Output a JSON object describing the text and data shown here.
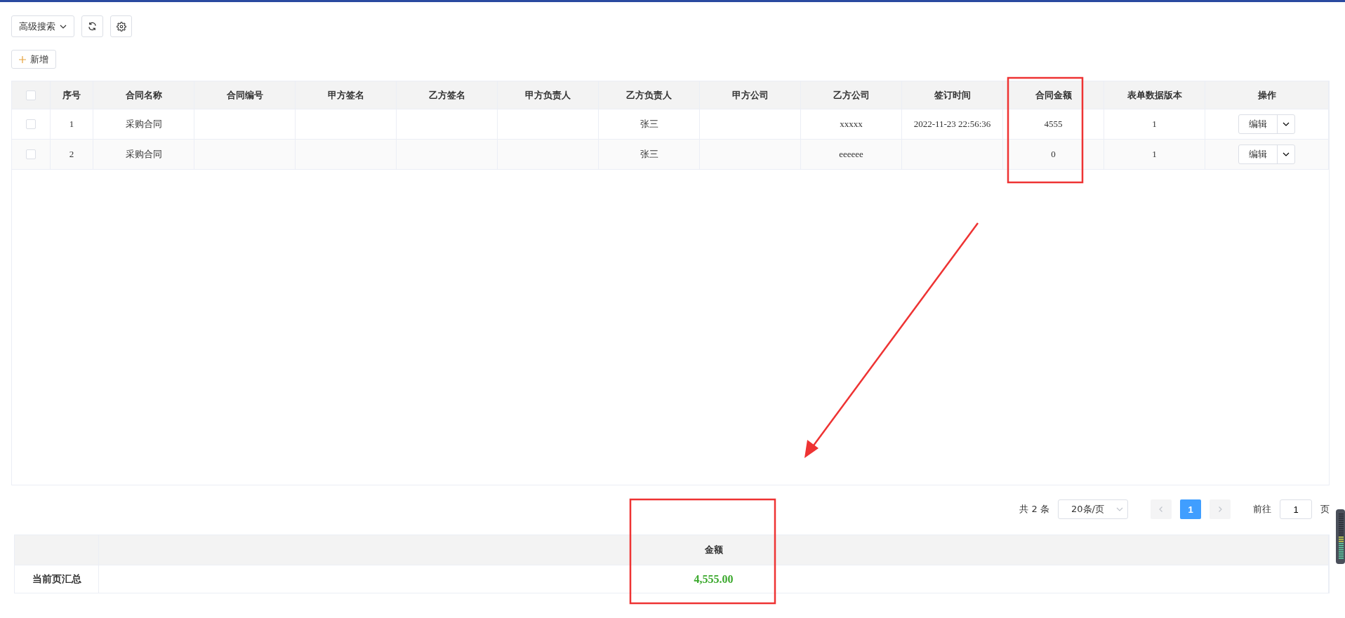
{
  "toolbar": {
    "search_button": "高级搜索",
    "add_button": "新增"
  },
  "table": {
    "columns": [
      "序号",
      "合同名称",
      "合同编号",
      "甲方签名",
      "乙方签名",
      "甲方负责人",
      "乙方负责人",
      "甲方公司",
      "乙方公司",
      "签订时间",
      "合同金额",
      "表单数据版本",
      "操作"
    ],
    "header_checked": false,
    "rows": [
      {
        "checked": false,
        "cells": [
          "1",
          "采购合同",
          "",
          "",
          "",
          "",
          "张三",
          "",
          "xxxxx",
          "2022-11-23 22:56:36",
          "4555",
          "1"
        ],
        "action": "编辑"
      },
      {
        "checked": false,
        "cells": [
          "2",
          "采购合同",
          "",
          "",
          "",
          "",
          "张三",
          "",
          "eeeeee",
          "",
          "0",
          "1"
        ],
        "action": "编辑"
      }
    ]
  },
  "pagination": {
    "total": "共 2 条",
    "page_size": "20条/页",
    "pages": [
      {
        "label": "1",
        "selected": true
      }
    ],
    "goto_label": "前往",
    "goto_value": "1",
    "goto_suffix": "页"
  },
  "summary": {
    "column": "金额",
    "row_label": "当前页汇总",
    "value": "4,555.00"
  }
}
